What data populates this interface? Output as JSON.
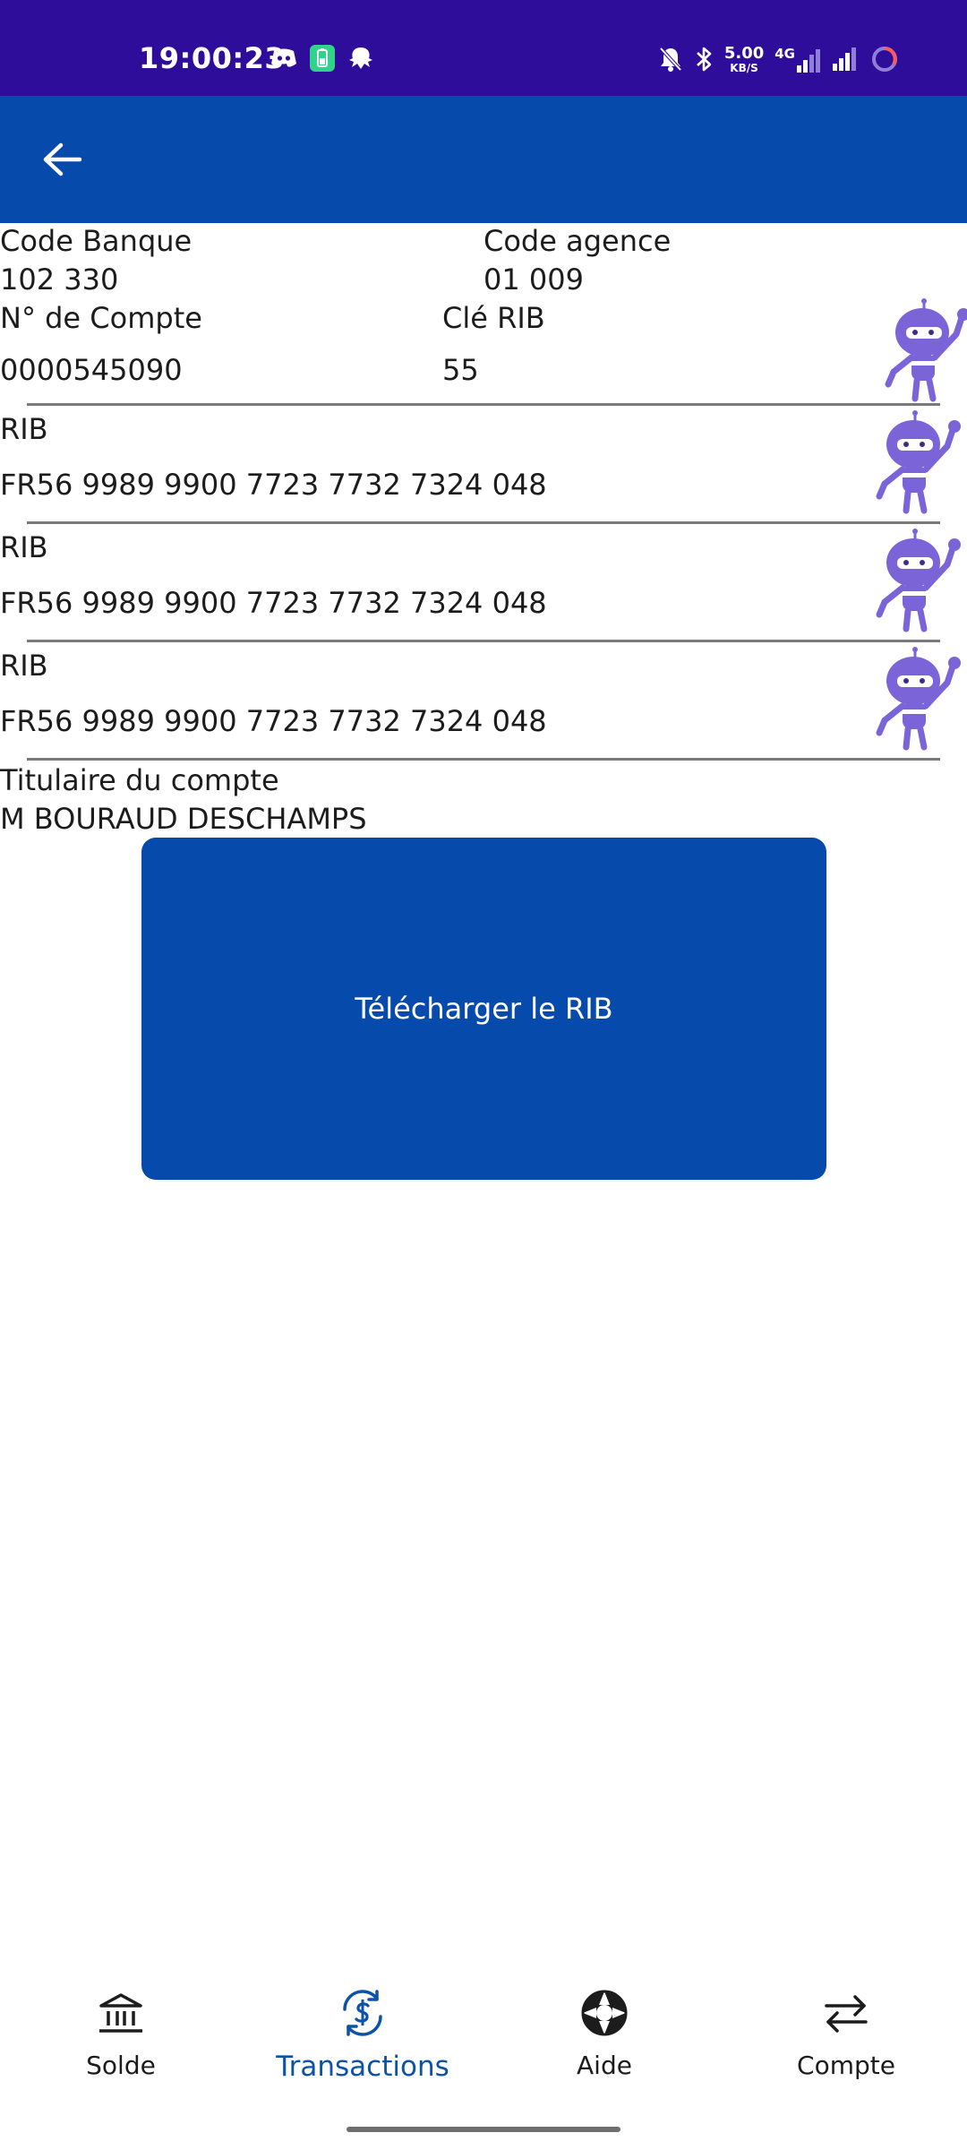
{
  "status_bar": {
    "time": "19:00:23",
    "speed_value": "5.00",
    "speed_unit": "KB/S",
    "network": "4G",
    "icons_left": [
      "discord-icon",
      "battery-saver-icon",
      "octopus-icon"
    ],
    "icons_right": [
      "bell-muted-icon",
      "bluetooth-icon",
      "signal-icon",
      "signal-icon",
      "loading-ring-icon"
    ]
  },
  "header": {
    "back_icon": "arrow-left-icon",
    "background": "#064aab"
  },
  "bank": {
    "code_banque_label": "Code Banque",
    "code_banque_value": "102 330",
    "code_agence_label": "Code agence",
    "code_agence_value": "01 009"
  },
  "account": {
    "numero_label": "N° de Compte",
    "numero_value": "0000545090",
    "cle_label": "Clé RIB",
    "cle_value": "55"
  },
  "rib_entries": [
    {
      "label": "RIB",
      "value": "FR56 9989 9900 7723 7732 7324 048"
    },
    {
      "label": "RIB",
      "value": "FR56 9989 9900 7723 7732 7324 048"
    },
    {
      "label": "RIB",
      "value": "FR56 9989 9900 7723 7732 7324 048"
    }
  ],
  "holder": {
    "label": "Titulaire du compte",
    "value": "M BOURAUD DESCHAMPS"
  },
  "download_button": {
    "label": "Télécharger le RIB",
    "color": "#064aab"
  },
  "bottom_nav": {
    "active": "Transactions",
    "active_color": "#0b52a8",
    "items": [
      {
        "label": "Solde",
        "icon": "bank-icon"
      },
      {
        "label": "Transactions",
        "icon": "dollar-cycle-icon"
      },
      {
        "label": "Aide",
        "icon": "lifebuoy-icon"
      },
      {
        "label": "Compte",
        "icon": "transfer-arrows-icon"
      }
    ]
  }
}
